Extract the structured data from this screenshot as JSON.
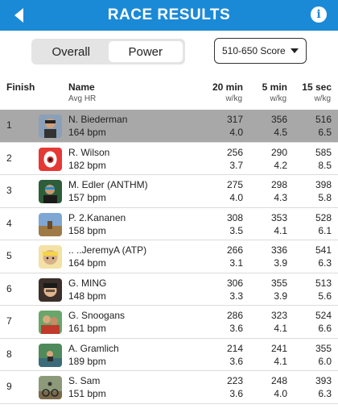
{
  "header": {
    "title": "RACE RESULTS",
    "back_icon": "back-arrow-icon",
    "info_label": "i"
  },
  "tabs": [
    {
      "label": "Overall",
      "active": false
    },
    {
      "label": "Power",
      "active": true
    }
  ],
  "score_filter": {
    "value": "510-650 Score"
  },
  "columns": {
    "finish": "Finish",
    "name": "Name",
    "name_sub": "Avg HR",
    "c1": "20 min",
    "c2": "5 min",
    "c3": "15 sec",
    "unit": "w/kg"
  },
  "results": [
    {
      "pos": "1",
      "name": "N. Biederman",
      "hr": "164 bpm",
      "p20": "317",
      "w20": "4.0",
      "p5": "356",
      "w5": "4.5",
      "p15": "516",
      "w15": "6.5",
      "highlight": true
    },
    {
      "pos": "2",
      "name": "R. Wilson",
      "hr": "182 bpm",
      "p20": "256",
      "w20": "3.7",
      "p5": "290",
      "w5": "4.2",
      "p15": "585",
      "w15": "8.5"
    },
    {
      "pos": "3",
      "name": "M. Edler (ANTHM)",
      "hr": "157 bpm",
      "p20": "275",
      "w20": "4.0",
      "p5": "298",
      "w5": "4.3",
      "p15": "398",
      "w15": "5.8"
    },
    {
      "pos": "4",
      "name": "P. 2.Kananen",
      "hr": "158 bpm",
      "p20": "308",
      "w20": "3.5",
      "p5": "353",
      "w5": "4.1",
      "p15": "528",
      "w15": "6.1"
    },
    {
      "pos": "5",
      "name": ".. ..JeremyA (ATP)",
      "hr": "164 bpm",
      "p20": "266",
      "w20": "3.1",
      "p5": "336",
      "w5": "3.9",
      "p15": "541",
      "w15": "6.3"
    },
    {
      "pos": "6",
      "name": "G. MING",
      "hr": "148 bpm",
      "p20": "306",
      "w20": "3.3",
      "p5": "355",
      "w5": "3.9",
      "p15": "513",
      "w15": "5.6"
    },
    {
      "pos": "7",
      "name": "G. Snoogans",
      "hr": "161 bpm",
      "p20": "286",
      "w20": "3.6",
      "p5": "323",
      "w5": "4.1",
      "p15": "524",
      "w15": "6.6"
    },
    {
      "pos": "8",
      "name": "A. Gramlich",
      "hr": "189 bpm",
      "p20": "214",
      "w20": "3.6",
      "p5": "241",
      "w5": "4.1",
      "p15": "355",
      "w15": "6.0"
    },
    {
      "pos": "9",
      "name": "S. Sam",
      "hr": "151 bpm",
      "p20": "223",
      "w20": "3.6",
      "p5": "248",
      "w5": "4.0",
      "p15": "393",
      "w15": "6.3"
    }
  ],
  "colors": {
    "header_bg": "#1b8ad6",
    "highlight_row": "#a8a8a8"
  }
}
